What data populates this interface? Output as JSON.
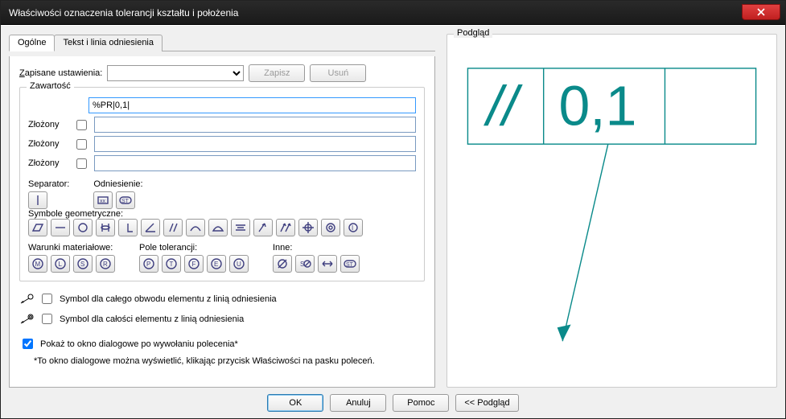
{
  "window": {
    "title": "Właściwości oznaczenia tolerancji kształtu i położenia"
  },
  "tabs": {
    "general": "Ogólne",
    "text_leader": "Tekst i linia odniesienia"
  },
  "saved_settings": {
    "label": "Zapisane ustawienia:",
    "combo_value": "",
    "save_btn": "Zapisz",
    "delete_btn": "Usuń"
  },
  "content": {
    "legend": "Zawartość",
    "main_value": "%PR|0,1|",
    "compound_label": "Złożony",
    "rows": [
      {
        "checked": false,
        "value": ""
      },
      {
        "checked": false,
        "value": ""
      },
      {
        "checked": false,
        "value": ""
      }
    ]
  },
  "sections": {
    "separator_label": "Separator:",
    "reference_label": "Odniesienie:",
    "geom_label": "Symbole geometryczne:",
    "material_label": "Warunki materiałowe:",
    "field_label": "Pole tolerancji:",
    "other_label": "Inne:"
  },
  "options": {
    "symbol_perimeter": "Symbol dla całego obwodu elementu z linią odniesienia",
    "symbol_whole": "Symbol dla całości elementu z linią odniesienia",
    "perimeter_checked": false,
    "whole_checked": false,
    "show_dialog": "Pokaż to okno dialogowe po wywołaniu polecenia*",
    "show_dialog_checked": true,
    "note": "*To okno dialogowe można wyświetlić, klikając przycisk Właściwości na pasku poleceń."
  },
  "preview": {
    "legend": "Podgląd",
    "symbol": "//",
    "value": "0,1"
  },
  "buttons": {
    "ok": "OK",
    "cancel": "Anuluj",
    "help": "Pomoc",
    "preview": "<< Podgląd"
  },
  "colors": {
    "accent": "#0a8a8a"
  }
}
